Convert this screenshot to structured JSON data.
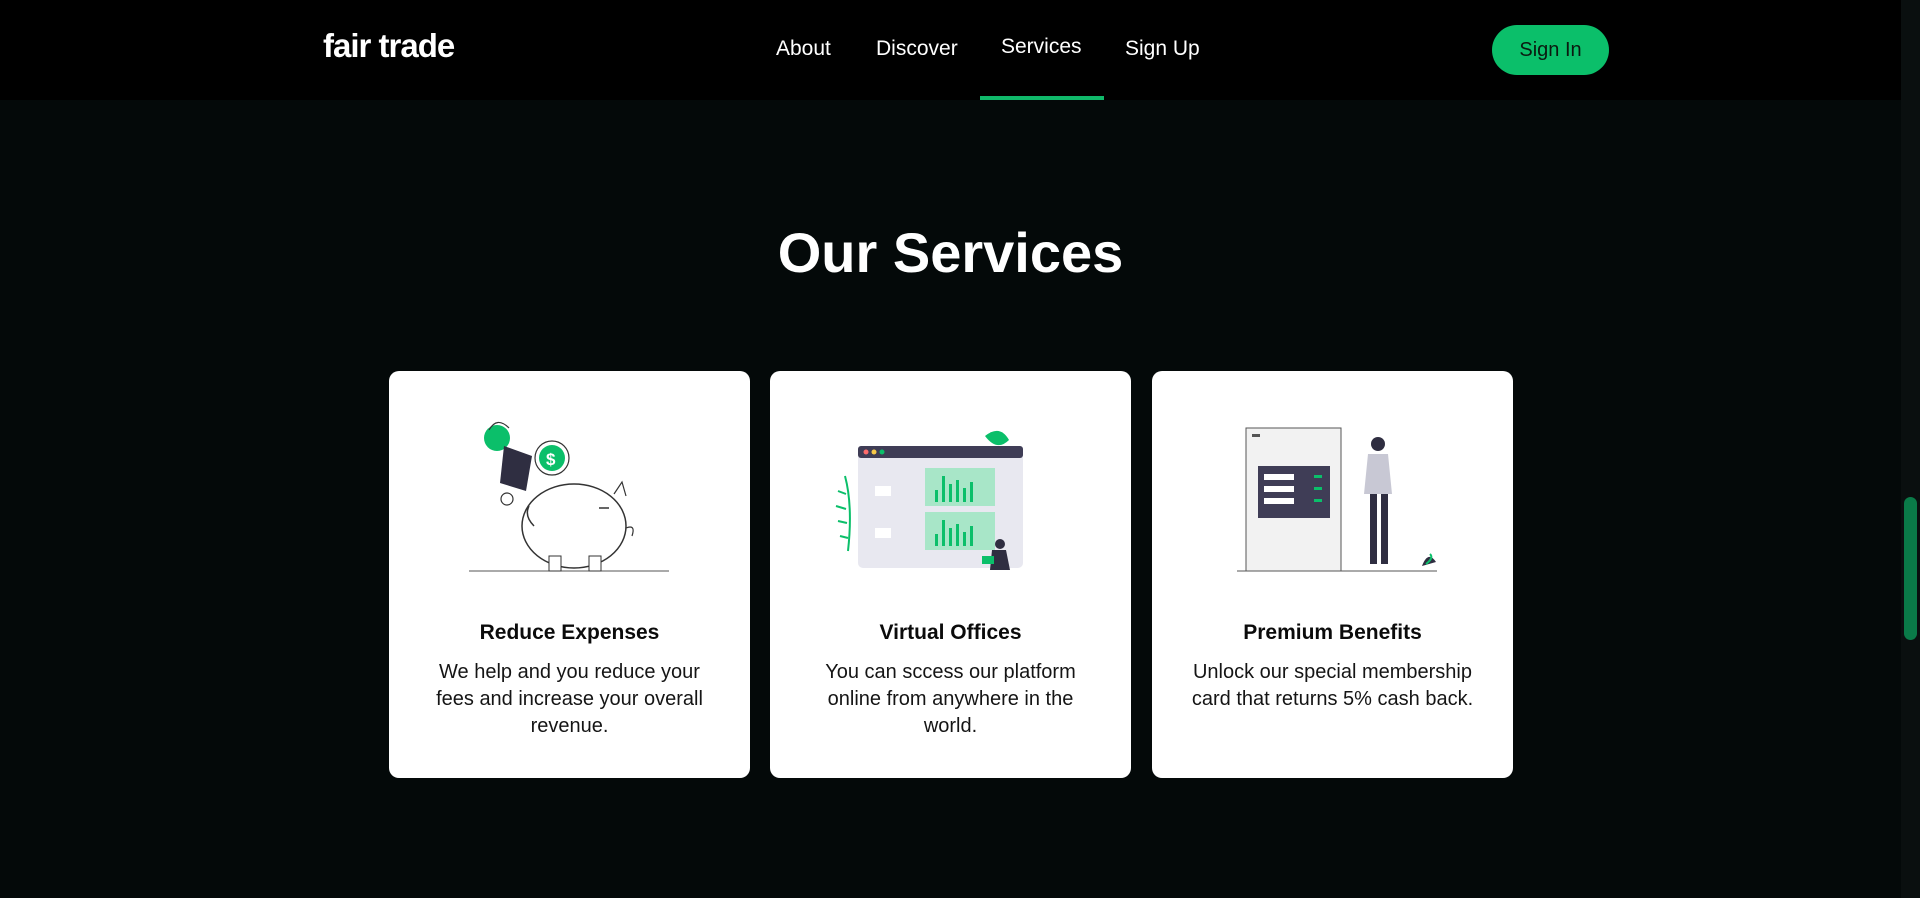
{
  "colors": {
    "accent": "#0bbf6a",
    "background": "#040909",
    "navbar": "#000000",
    "card": "#ffffff"
  },
  "navbar": {
    "logo": "fair trade",
    "items": [
      {
        "label": "About"
      },
      {
        "label": "Discover"
      },
      {
        "label": "Services",
        "active": true
      },
      {
        "label": "Sign Up"
      }
    ],
    "signin_label": "Sign In"
  },
  "services": {
    "title": "Our Services",
    "cards": [
      {
        "illustration": "piggy-bank-illustration",
        "title": "Reduce Expenses",
        "description": "We help and you reduce your fees and increase your overall revenue."
      },
      {
        "illustration": "virtual-office-illustration",
        "title": "Virtual Offices",
        "description": "You can sccess our platform online from anywhere in the world."
      },
      {
        "illustration": "membership-card-illustration",
        "title": "Premium Benefits",
        "description": "Unlock our special membership card that returns 5% cash back."
      }
    ]
  }
}
